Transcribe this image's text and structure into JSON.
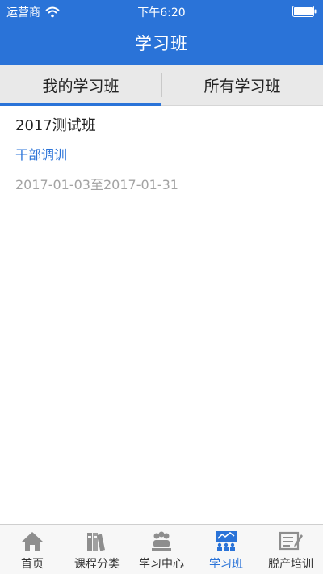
{
  "status_bar": {
    "carrier": "运营商",
    "time": "下午6:20",
    "wifi_icon": "wifi-icon",
    "battery_icon": "battery-icon"
  },
  "nav": {
    "title": "学习班"
  },
  "tabs": [
    {
      "label": "我的学习班",
      "active": true
    },
    {
      "label": "所有学习班",
      "active": false
    }
  ],
  "classes": [
    {
      "title": "2017测试班",
      "category": "干部调训",
      "dates": "2017-01-03至2017-01-31"
    }
  ],
  "tabbar": {
    "items": [
      {
        "label": "首页",
        "icon": "home-icon",
        "active": false
      },
      {
        "label": "课程分类",
        "icon": "books-icon",
        "active": false
      },
      {
        "label": "学习中心",
        "icon": "people-icon",
        "active": false
      },
      {
        "label": "学习班",
        "icon": "class-board-icon",
        "active": true
      },
      {
        "label": "脱产培训",
        "icon": "training-edit-icon",
        "active": false
      }
    ]
  },
  "colors": {
    "accent": "#2a73d8",
    "muted_text": "#a3a3a3",
    "inactive_icon": "#8e8e8e"
  }
}
